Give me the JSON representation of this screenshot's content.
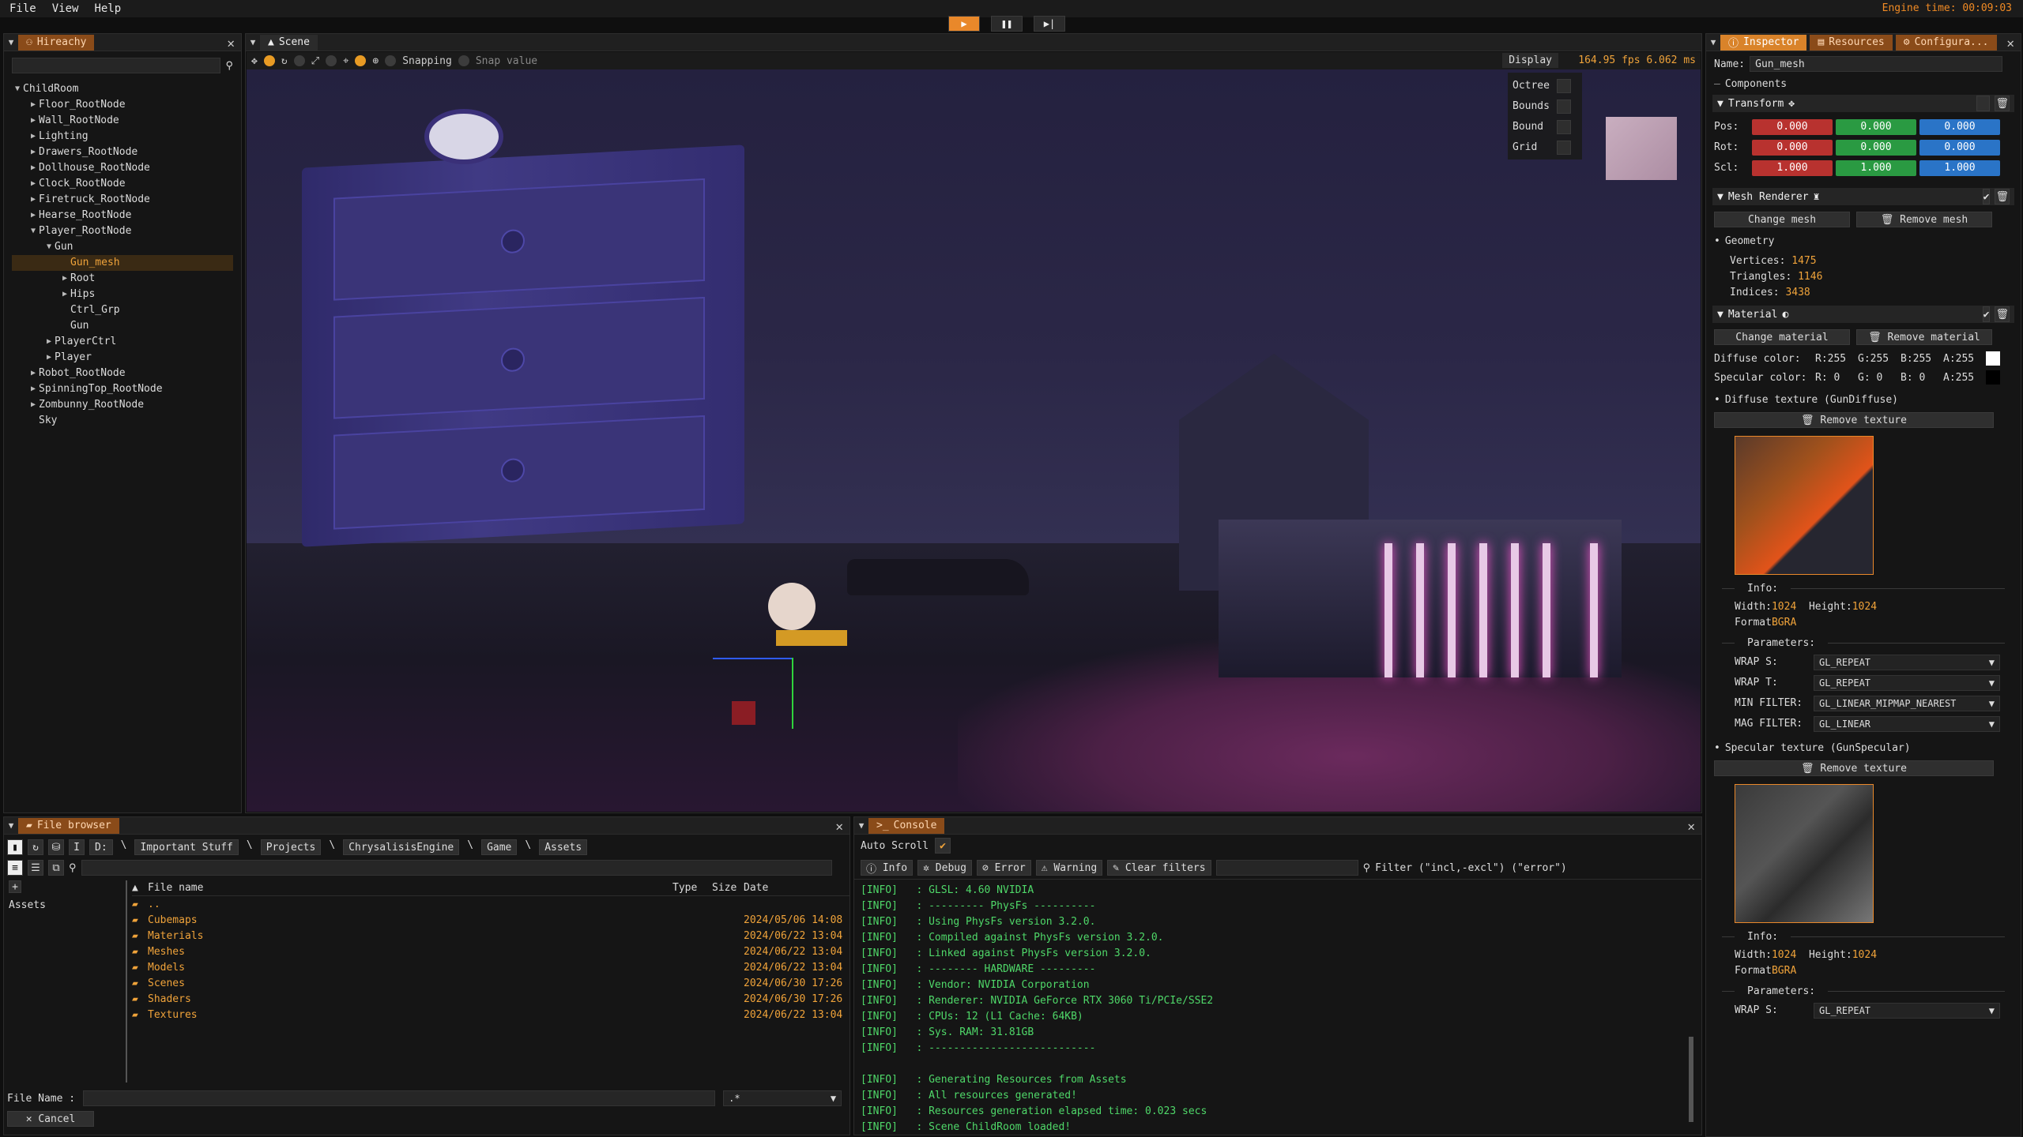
{
  "menu": {
    "file": "File",
    "view": "View",
    "help": "Help"
  },
  "engine_time": "Engine time: 00:09:03",
  "hierarchy": {
    "tab": "Hireachy",
    "nodes": [
      {
        "label": "ChildRoom",
        "depth": 0,
        "arrow": "▼",
        "selected": false
      },
      {
        "label": "Floor_RootNode",
        "depth": 1,
        "arrow": "▶",
        "selected": false
      },
      {
        "label": "Wall_RootNode",
        "depth": 1,
        "arrow": "▶",
        "selected": false
      },
      {
        "label": "Lighting",
        "depth": 1,
        "arrow": "▶",
        "selected": false
      },
      {
        "label": "Drawers_RootNode",
        "depth": 1,
        "arrow": "▶",
        "selected": false
      },
      {
        "label": "Dollhouse_RootNode",
        "depth": 1,
        "arrow": "▶",
        "selected": false
      },
      {
        "label": "Clock_RootNode",
        "depth": 1,
        "arrow": "▶",
        "selected": false
      },
      {
        "label": "Firetruck_RootNode",
        "depth": 1,
        "arrow": "▶",
        "selected": false
      },
      {
        "label": "Hearse_RootNode",
        "depth": 1,
        "arrow": "▶",
        "selected": false
      },
      {
        "label": "Player_RootNode",
        "depth": 1,
        "arrow": "▼",
        "selected": false
      },
      {
        "label": "Gun",
        "depth": 2,
        "arrow": "▼",
        "selected": false
      },
      {
        "label": "Gun_mesh",
        "depth": 3,
        "arrow": "",
        "selected": true
      },
      {
        "label": "Root",
        "depth": 3,
        "arrow": "▶",
        "selected": false
      },
      {
        "label": "Hips",
        "depth": 3,
        "arrow": "▶",
        "selected": false
      },
      {
        "label": "Ctrl_Grp",
        "depth": 3,
        "arrow": "",
        "selected": false
      },
      {
        "label": "Gun",
        "depth": 3,
        "arrow": "",
        "selected": false
      },
      {
        "label": "PlayerCtrl",
        "depth": 2,
        "arrow": "▶",
        "selected": false
      },
      {
        "label": "Player",
        "depth": 2,
        "arrow": "▶",
        "selected": false
      },
      {
        "label": "Robot_RootNode",
        "depth": 1,
        "arrow": "▶",
        "selected": false
      },
      {
        "label": "SpinningTop_RootNode",
        "depth": 1,
        "arrow": "▶",
        "selected": false
      },
      {
        "label": "Zombunny_RootNode",
        "depth": 1,
        "arrow": "▶",
        "selected": false
      },
      {
        "label": "Sky",
        "depth": 1,
        "arrow": "",
        "selected": false
      }
    ]
  },
  "scene": {
    "tab": "Scene",
    "snapping": "Snapping",
    "snap_value": "Snap value",
    "display": "Display",
    "fps": "164.95 fps 6.062 ms",
    "display_options": [
      "Octree",
      "Bounds",
      "Bound",
      "Grid"
    ]
  },
  "inspector": {
    "tabs": [
      "Inspector",
      "Resources",
      "Configura..."
    ],
    "name_label": "Name:",
    "name_value": "Gun_mesh",
    "components": "Components",
    "transform": "Transform",
    "pos_label": "Pos:",
    "rot_label": "Rot:",
    "scl_label": "Scl:",
    "pos": [
      "0.000",
      "0.000",
      "0.000"
    ],
    "rot": [
      "0.000",
      "0.000",
      "0.000"
    ],
    "scl": [
      "1.000",
      "1.000",
      "1.000"
    ],
    "mesh_renderer": "Mesh Renderer",
    "change_mesh": "Change mesh",
    "remove_mesh": "Remove mesh",
    "geometry": "Geometry",
    "vertices_label": "Vertices:",
    "vertices": "1475",
    "triangles_label": "Triangles:",
    "triangles": "1146",
    "indices_label": "Indices:",
    "indices": "3438",
    "material": "Material",
    "change_material": "Change material",
    "remove_material": "Remove material",
    "diffuse_label": "Diffuse color:",
    "diffuse": [
      "R:255",
      "G:255",
      "B:255",
      "A:255"
    ],
    "specular_label": "Specular color:",
    "specular": [
      "R:  0",
      "G:  0",
      "B:  0",
      "A:255"
    ],
    "diffuse_texture": "Diffuse texture (GunDiffuse)",
    "remove_texture": "Remove texture",
    "info": "Info:",
    "width_label": "Width:",
    "width": "1024",
    "height_label": "Height:",
    "height": "1024",
    "format_label": "Format",
    "format": "BGRA",
    "parameters": "Parameters:",
    "wrap_s_label": "WRAP S:",
    "wrap_s": "GL_REPEAT",
    "wrap_t_label": "WRAP T:",
    "wrap_t": "GL_REPEAT",
    "min_label": "MIN FILTER:",
    "min": "GL_LINEAR_MIPMAP_NEAREST",
    "mag_label": "MAG FILTER:",
    "mag": "GL_LINEAR",
    "specular_texture": "Specular texture (GunSpecular)"
  },
  "file_browser": {
    "tab": "File browser",
    "path": [
      "D:",
      "\\",
      "Important Stuff",
      "\\",
      "Projects",
      "\\",
      "ChrysalisisEngine",
      "\\",
      "Game",
      "\\",
      "Assets"
    ],
    "tree_root": "Assets",
    "col_name": "File name",
    "col_type": "Type",
    "col_size": "Size",
    "col_date": "Date",
    "files": [
      {
        "name": "..",
        "date": ""
      },
      {
        "name": "Cubemaps",
        "date": "2024/05/06 14:08"
      },
      {
        "name": "Materials",
        "date": "2024/06/22 13:04"
      },
      {
        "name": "Meshes",
        "date": "2024/06/22 13:04"
      },
      {
        "name": "Models",
        "date": "2024/06/22 13:04"
      },
      {
        "name": "Scenes",
        "date": "2024/06/30 17:26"
      },
      {
        "name": "Shaders",
        "date": "2024/06/30 17:26"
      },
      {
        "name": "Textures",
        "date": "2024/06/22 13:04"
      }
    ],
    "file_name_label": "File Name :",
    "filter": ".*",
    "cancel": "Cancel"
  },
  "console": {
    "tab": "Console",
    "auto_scroll": "Auto Scroll",
    "filters": [
      "Info",
      "Debug",
      "Error",
      "Warning",
      "Clear filters"
    ],
    "filter_hint": "Filter (\"incl,-excl\") (\"error\")",
    "lines": [
      "[INFO]   : GLSL: 4.60 NVIDIA",
      "[INFO]   : --------- PhysFs ----------",
      "[INFO]   : Using PhysFs version 3.2.0.",
      "[INFO]   : Compiled against PhysFs version 3.2.0.",
      "[INFO]   : Linked against PhysFs version 3.2.0.",
      "[INFO]   : -------- HARDWARE ---------",
      "[INFO]   : Vendor: NVIDIA Corporation",
      "[INFO]   : Renderer: NVIDIA GeForce RTX 3060 Ti/PCIe/SSE2",
      "[INFO]   : CPUs: 12 (L1 Cache: 64KB)",
      "[INFO]   : Sys. RAM: 31.81GB",
      "[INFO]   : ---------------------------",
      "",
      "[INFO]   : Generating Resources from Assets",
      "[INFO]   : All resources generated!",
      "[INFO]   : Resources generation elapsed time: 0.023 secs",
      "[INFO]   : Scene ChildRoom loaded!"
    ]
  },
  "colors": {
    "accent": "#e9882a",
    "green_log": "#4fd869",
    "selected": "#f0a33a"
  }
}
